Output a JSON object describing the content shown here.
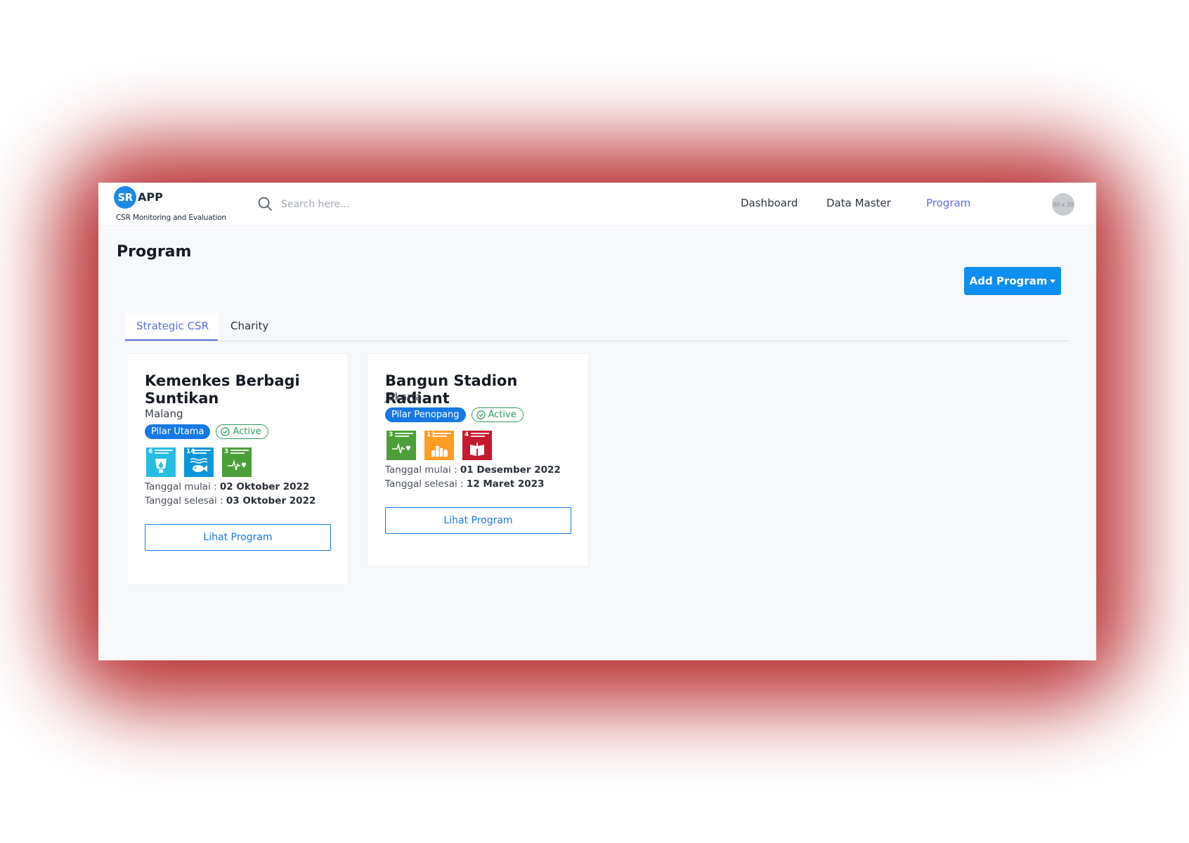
{
  "brand": {
    "badge": "SR",
    "name": "APP",
    "subtitle": "CSR Monitoring and Evaluation"
  },
  "search": {
    "placeholder": "Search here..."
  },
  "nav": [
    {
      "label": "Dashboard",
      "active": false
    },
    {
      "label": "Data Master",
      "active": false
    },
    {
      "label": "Program",
      "active": true
    }
  ],
  "avatar": {
    "label": "30 x 30"
  },
  "page": {
    "title": "Program",
    "add_button": "Add Program"
  },
  "tabs": [
    {
      "label": "Strategic CSR",
      "active": true
    },
    {
      "label": "Charity",
      "active": false
    }
  ],
  "programs": [
    {
      "title": "Kemenkes Berbagi Suntikan",
      "location": "Malang",
      "pillar": "Pilar Utama",
      "status": "Active",
      "sdgs": [
        {
          "num": "6",
          "color": "#26bde2",
          "icon": "clean-water-icon"
        },
        {
          "num": "14",
          "color": "#0a97d9",
          "icon": "life-below-water-icon"
        },
        {
          "num": "3",
          "color": "#4c9f38",
          "icon": "good-health-icon"
        }
      ],
      "start_label": "Tanggal mulai : ",
      "start_date": "02 Oktober 2022",
      "end_label": "Tanggal selesai : ",
      "end_date": "03 Oktober 2022",
      "button": "Lihat Program"
    },
    {
      "title": "Bangun Stadion Radiant",
      "location": "Jakarta",
      "pillar": "Pilar Penopang",
      "status": "Active",
      "sdgs": [
        {
          "num": "3",
          "color": "#4c9f38",
          "icon": "good-health-icon"
        },
        {
          "num": "11",
          "color": "#fd9d24",
          "icon": "sustainable-cities-icon"
        },
        {
          "num": "4",
          "color": "#c5192d",
          "icon": "quality-education-icon"
        }
      ],
      "start_label": "Tanggal mulai : ",
      "start_date": "01 Desember 2022",
      "end_label": "Tanggal selesai : ",
      "end_date": "12 Maret 2023",
      "button": "Lihat Program"
    }
  ]
}
